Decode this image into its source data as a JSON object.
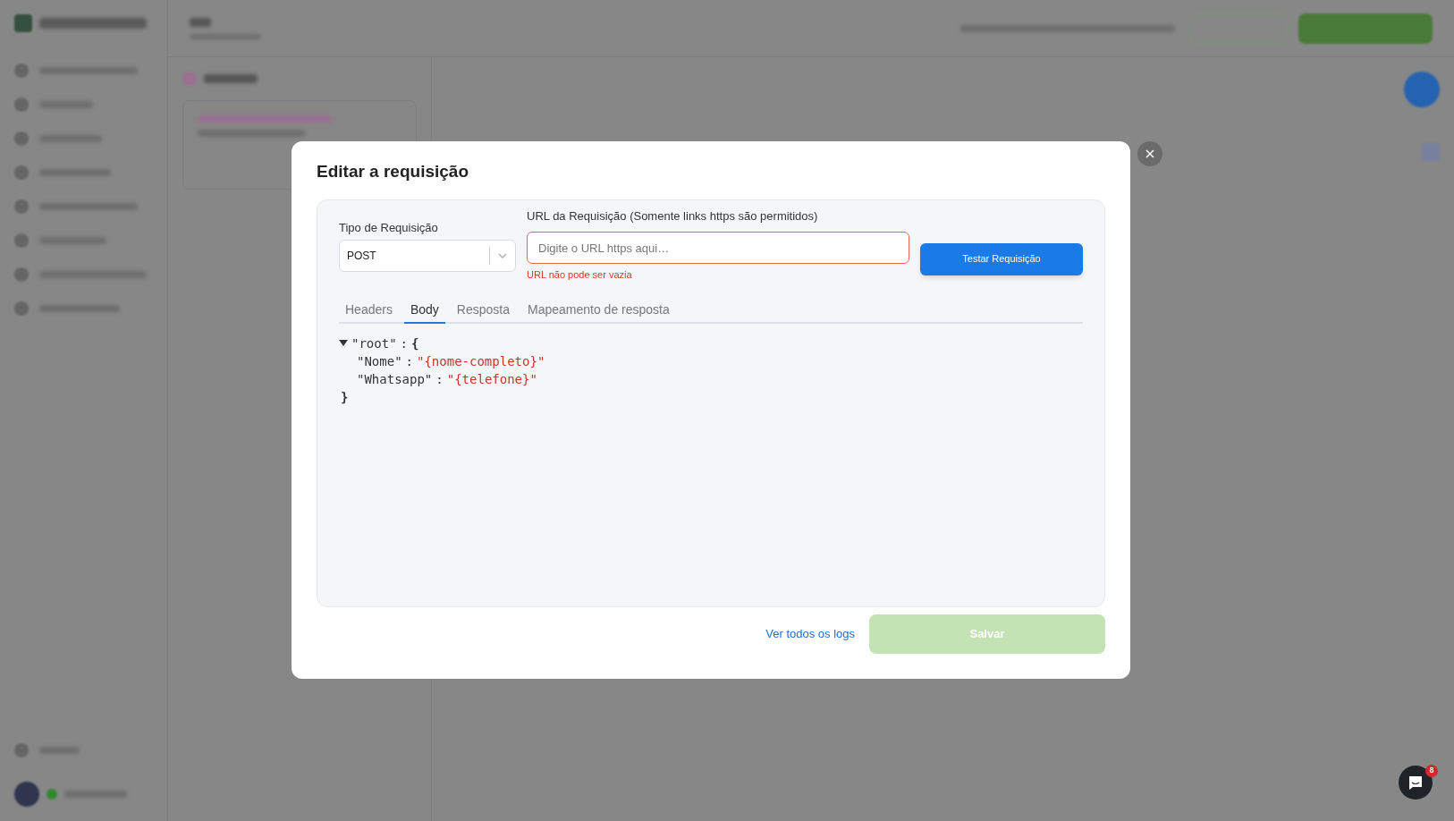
{
  "modal": {
    "title": "Editar a requisição",
    "request_type": {
      "label": "Tipo de Requisição",
      "value": "POST"
    },
    "url": {
      "label": "URL da Requisição (Somente links https são permitidos)",
      "placeholder": "Digite o URL https aqui…",
      "error": "URL não pode ser vazia",
      "invalid": true
    },
    "test_button": "Testar Requisição",
    "tabs": [
      {
        "label": "Headers",
        "selected": false
      },
      {
        "label": "Body",
        "selected": true
      },
      {
        "label": "Resposta",
        "selected": false
      },
      {
        "label": "Mapeamento de resposta",
        "selected": false
      }
    ],
    "body_json": {
      "key": "\"root\"",
      "separator": ":",
      "open": "{",
      "close": "}",
      "expanded": true,
      "entries": [
        {
          "key": "\"Nome\"",
          "value": "\"{nome-completo}\""
        },
        {
          "key": "\"Whatsapp\"",
          "value": "\"{telefone}\""
        }
      ]
    },
    "logs_link": "Ver todos os logs",
    "save_button": {
      "label": "Salvar",
      "disabled": true
    }
  },
  "chat_launcher": {
    "badge": "8"
  }
}
